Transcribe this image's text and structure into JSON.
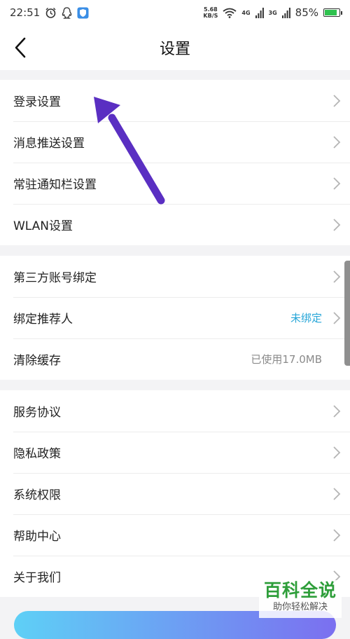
{
  "status_bar": {
    "time": "22:51",
    "net_speed_value": "5.68",
    "net_speed_unit": "KB/S",
    "network_1": "4G",
    "network_2": "3G",
    "battery_percent": "85%",
    "battery_level": 0.85
  },
  "header": {
    "title": "设置"
  },
  "groups": [
    {
      "items": [
        {
          "label": "登录设置"
        },
        {
          "label": "消息推送设置"
        },
        {
          "label": "常驻通知栏设置"
        },
        {
          "label": "WLAN设置"
        }
      ]
    },
    {
      "items": [
        {
          "label": "第三方账号绑定"
        },
        {
          "label": "绑定推荐人",
          "value": "未绑定"
        },
        {
          "label": "清除缓存",
          "value": "已使用17.0MB"
        }
      ]
    },
    {
      "items": [
        {
          "label": "服务协议"
        },
        {
          "label": "隐私政策"
        },
        {
          "label": "系统权限"
        },
        {
          "label": "帮助中心"
        },
        {
          "label": "关于我们"
        }
      ]
    }
  ],
  "watermark": {
    "title": "百科全说",
    "subtitle": "助你轻松解决"
  },
  "colors": {
    "accent_link": "#27a6d8",
    "annotation_arrow": "#5a2fc2",
    "watermark_green": "#2e9e3a",
    "battery_green": "#2fc24f"
  }
}
